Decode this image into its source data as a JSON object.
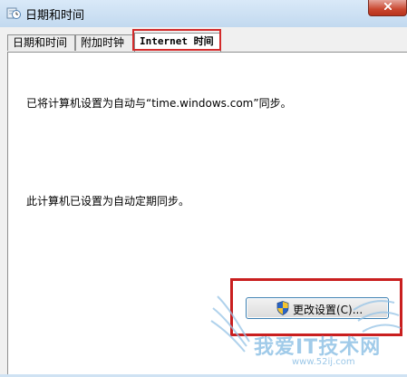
{
  "window": {
    "title": "日期和时间"
  },
  "tabs": [
    {
      "label": "日期和时间",
      "active": false
    },
    {
      "label": "附加时钟",
      "active": false
    },
    {
      "label": "Internet 时间",
      "active": true
    }
  ],
  "panel": {
    "sync_status": "已将计算机设置为自动与“time.windows.com”同步。",
    "schedule_status": "此计算机已设置为自动定期同步。",
    "change_settings_button": "更改设置(C)..."
  },
  "watermark": {
    "name": "我爱IT技术网",
    "url": "www.52ij.com"
  },
  "colors": {
    "highlight_box": "#c91f1f",
    "watermark": "#82b9e1"
  },
  "icons": {
    "app": "clock-app-icon",
    "button": "uac-shield-icon",
    "window_close": "close-icon"
  }
}
